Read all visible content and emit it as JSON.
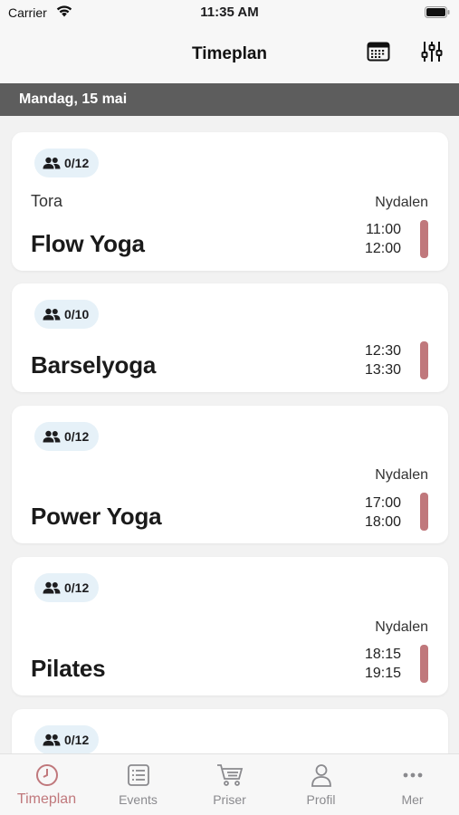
{
  "status_bar": {
    "carrier": "Carrier",
    "time": "11:35 AM"
  },
  "nav": {
    "title": "Timeplan",
    "calendar_icon": "calendar-icon",
    "filter_icon": "sliders-icon"
  },
  "date_header": "Mandag, 15 mai",
  "accent_color": "#c0787c",
  "classes": [
    {
      "capacity": "0/12",
      "instructor": "Tora",
      "location": "Nydalen",
      "name": "Flow Yoga",
      "start": "11:00",
      "end": "12:00",
      "color": "#c0787c"
    },
    {
      "capacity": "0/10",
      "instructor": "",
      "location": "",
      "name": "Barselyoga",
      "start": "12:30",
      "end": "13:30",
      "color": "#c0787c"
    },
    {
      "capacity": "0/12",
      "instructor": "",
      "location": "Nydalen",
      "name": "Power Yoga",
      "start": "17:00",
      "end": "18:00",
      "color": "#c0787c"
    },
    {
      "capacity": "0/12",
      "instructor": "",
      "location": "Nydalen",
      "name": "Pilates",
      "start": "18:15",
      "end": "19:15",
      "color": "#c0787c"
    },
    {
      "capacity": "0/12"
    }
  ],
  "tabs": [
    {
      "label": "Timeplan",
      "icon": "clock-icon",
      "active": true
    },
    {
      "label": "Events",
      "icon": "list-icon",
      "active": false
    },
    {
      "label": "Priser",
      "icon": "cart-icon",
      "active": false
    },
    {
      "label": "Profil",
      "icon": "person-icon",
      "active": false
    },
    {
      "label": "Mer",
      "icon": "more-icon",
      "active": false
    }
  ]
}
